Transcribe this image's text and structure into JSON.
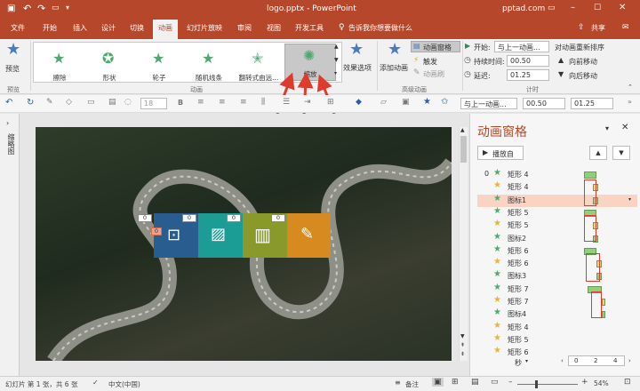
{
  "titlebar": {
    "title": "logo.pptx  -  PowerPoint",
    "site": "pptad.com"
  },
  "tabs": [
    {
      "label": "文件"
    },
    {
      "label": "开始"
    },
    {
      "label": "插入"
    },
    {
      "label": "设计"
    },
    {
      "label": "切换"
    },
    {
      "label": "动画"
    },
    {
      "label": "幻灯片放映"
    },
    {
      "label": "审阅"
    },
    {
      "label": "视图"
    },
    {
      "label": "开发工具"
    }
  ],
  "tell_me": "告诉我你想要做什么",
  "share": "共享",
  "ribbon": {
    "preview": "预览",
    "preview_group": "预览",
    "effects": [
      "擦除",
      "形状",
      "轮子",
      "随机线条",
      "翻转式由远...",
      "缩放"
    ],
    "effect_options": "效果选项",
    "anim_group": "动画",
    "add_animation": "添加动画",
    "anim_pane_btn": "动画窗格",
    "trigger": "触发",
    "anim_brush": "动画刷",
    "advanced_group": "高级动画",
    "start_label": "开始:",
    "start_value": "与上一动画...",
    "duration_label": "持续时间:",
    "duration_value": "00.50",
    "delay_label": "延迟:",
    "delay_value": "01.25",
    "reorder": "对动画重新排序",
    "move_earlier": "向前移动",
    "move_later": "向后移动",
    "timing_group": "计时"
  },
  "toolbar2": {
    "font_size": "18",
    "start_value": "与上一动画...",
    "duration": "00.50",
    "delay": "01.25"
  },
  "leftpanel": {
    "label": "缩略图"
  },
  "slide_tags": [
    "0",
    "0",
    "0",
    "0",
    "0"
  ],
  "anim_pane": {
    "title": "动画窗格",
    "play_from": "播放自",
    "items": [
      {
        "num": "0",
        "name": "矩形 4",
        "kind": "entry"
      },
      {
        "num": "",
        "name": "矩形 4",
        "kind": "emph"
      },
      {
        "num": "",
        "name": "图标1",
        "kind": "entry"
      },
      {
        "num": "",
        "name": "矩形 5",
        "kind": "entry"
      },
      {
        "num": "",
        "name": "矩形 5",
        "kind": "emph"
      },
      {
        "num": "",
        "name": "图标2",
        "kind": "entry"
      },
      {
        "num": "",
        "name": "矩形 6",
        "kind": "entry"
      },
      {
        "num": "",
        "name": "矩形 6",
        "kind": "emph"
      },
      {
        "num": "",
        "name": "图标3",
        "kind": "entry"
      },
      {
        "num": "",
        "name": "矩形 7",
        "kind": "entry"
      },
      {
        "num": "",
        "name": "矩形 7",
        "kind": "emph"
      },
      {
        "num": "",
        "name": "图标4",
        "kind": "entry"
      },
      {
        "num": "",
        "name": "矩形 4",
        "kind": "emph"
      },
      {
        "num": "",
        "name": "矩形 5",
        "kind": "emph"
      },
      {
        "num": "",
        "name": "矩形 6",
        "kind": "emph"
      }
    ],
    "seconds": "秒",
    "ruler": [
      "0",
      "2",
      "4"
    ]
  },
  "status": {
    "slide_info": "幻灯片 第 1 张，共 6 张",
    "lang": "中文(中国)",
    "notes": "备注",
    "zoom": "54%"
  },
  "colors": {
    "accent": "#b7472a",
    "tile1": "#2a5d8f",
    "tile2": "#1b9c95",
    "tile3": "#8a9a2a",
    "tile4": "#d68a1f",
    "arrow": "#e03a2f"
  }
}
